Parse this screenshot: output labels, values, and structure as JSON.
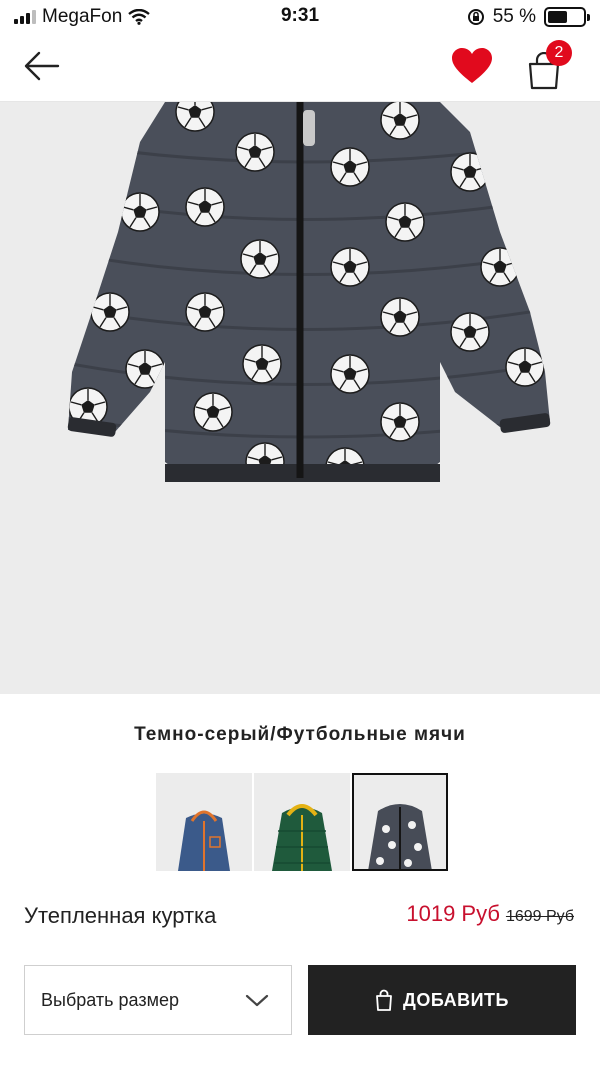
{
  "status_bar": {
    "carrier": "MegaFon",
    "time": "9:31",
    "battery": "55 %",
    "battery_level": 0.55
  },
  "nav": {
    "back_icon": "arrow-left-icon",
    "favorite_icon": "heart-icon",
    "bag_icon": "shopping-bag-icon",
    "bag_count": "2"
  },
  "product": {
    "color_name": "Темно-серый/Футбольные мячи",
    "name": "Утепленная куртка",
    "price_now": "1019 Руб",
    "price_old": "1699 Руб"
  },
  "swatches": [
    {
      "color": "navy-orange",
      "selected": false
    },
    {
      "color": "green-yellow",
      "selected": false
    },
    {
      "color": "darkgrey-footballs",
      "selected": true
    }
  ],
  "actions": {
    "size_label": "Выбрать размер",
    "add_label": "ДОБАВИТЬ"
  },
  "colors": {
    "accent_red": "#c8102e",
    "badge_red": "#e10a1d",
    "button_dark": "#222222"
  }
}
